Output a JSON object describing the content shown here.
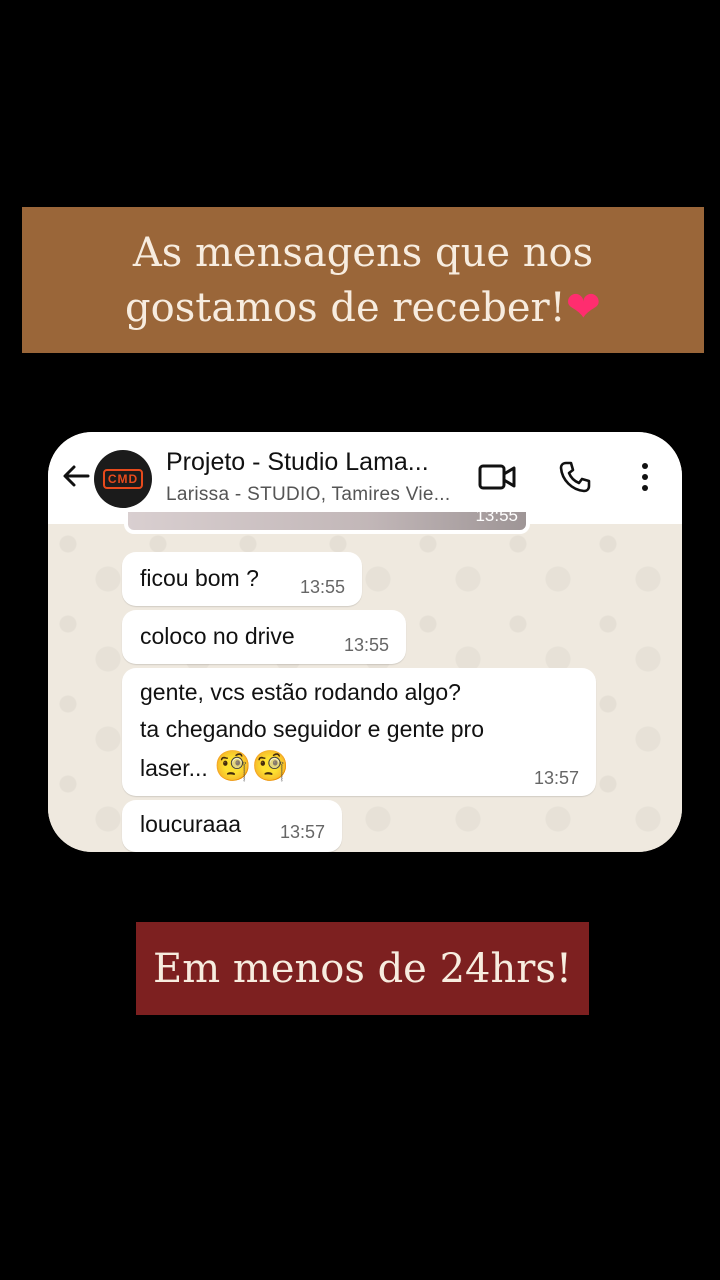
{
  "top_banner": {
    "text": "As mensagens que nos gostamos de receber!",
    "emoji": "❤"
  },
  "chat": {
    "title": "Projeto - Studio Lama...",
    "subtitle": "Larissa - STUDIO, Tamires Vie...",
    "avatar_text": "CMD",
    "previous_time": "13:55",
    "messages": [
      {
        "text": "ficou bom ?",
        "time": "13:55"
      },
      {
        "text": "coloco no drive",
        "time": "13:55"
      },
      {
        "text": "gente, vcs estão rodando algo?\nta chegando seguidor e gente pro",
        "text_last": "laser...",
        "emoji": "🧐🧐",
        "time": "13:57"
      },
      {
        "text": "loucuraaa",
        "time": "13:57"
      }
    ]
  },
  "bottom_banner": {
    "text": "Em menos de 24hrs!"
  },
  "colors": {
    "top_banner": "#9a6639",
    "bottom_banner": "#7d2020",
    "chat_bg": "#efe9df"
  }
}
